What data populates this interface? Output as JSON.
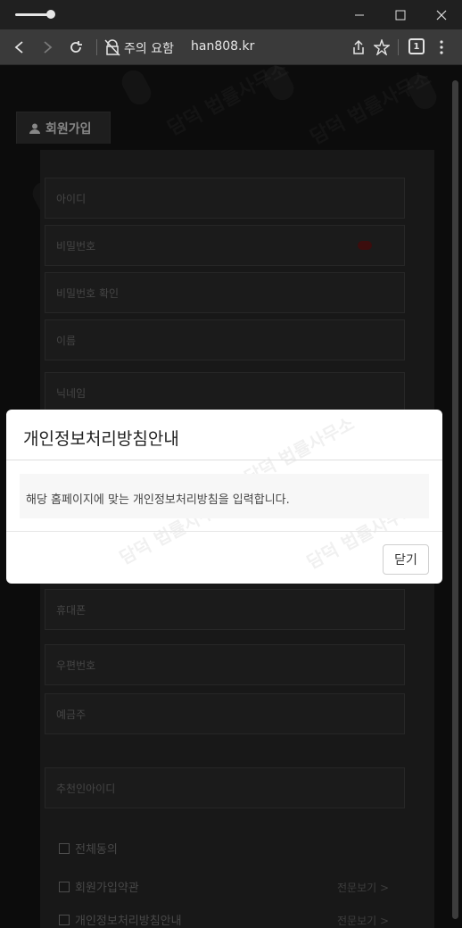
{
  "browser": {
    "security_warning": "주의 요함",
    "url": "han808.kr",
    "tab_count": "1"
  },
  "page": {
    "section_tab": "회원가입",
    "watermark_text": "담덕 법률사무소",
    "fields": [
      {
        "label": "아이디"
      },
      {
        "label": "비밀번호"
      },
      {
        "label": "비밀번호 확인"
      },
      {
        "label": "이름"
      },
      {
        "label": "닉네임"
      },
      {
        "label": "휴대폰"
      },
      {
        "label": "우편번호"
      },
      {
        "label": "예금주"
      },
      {
        "label": "추천인아이디"
      }
    ],
    "agreements": [
      {
        "label": "전체동의"
      },
      {
        "label": "회원가입약관",
        "link": "전문보기 >"
      },
      {
        "label": "개인정보처리방침안내",
        "link": "전문보기 >"
      }
    ]
  },
  "modal": {
    "title": "개인정보처리방침안내",
    "body": "해당 홈페이지에 맞는 개인정보처리방침을 입력합니다.",
    "close_label": "닫기"
  }
}
